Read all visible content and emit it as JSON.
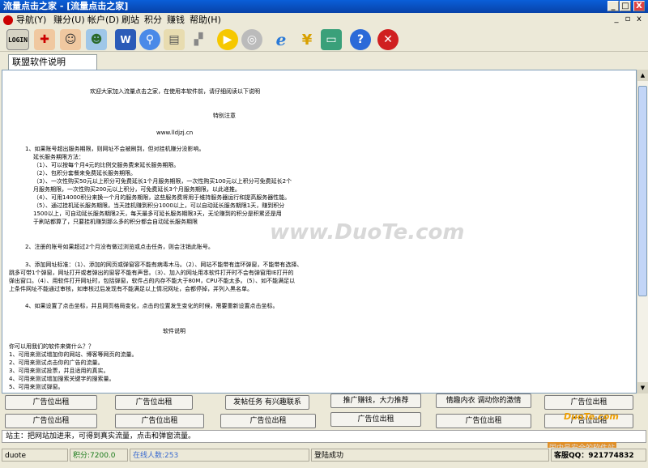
{
  "window": {
    "title": "流量点击之家 - [流量点击之家]",
    "buttons": [
      "_",
      "□",
      "X"
    ]
  },
  "menu": {
    "items": [
      "导航(Y)",
      "赚分(U)",
      "帐户(D)",
      "刷站",
      "积分",
      "赚钱",
      "帮助(H)"
    ],
    "mdi_buttons": [
      "_",
      "▫",
      "x"
    ]
  },
  "toolbar": {
    "icons": [
      "login-icon",
      "add-user-icon",
      "user-icon",
      "group-icon",
      "word-document-icon",
      "search-icon",
      "clipboard-icon",
      "signal-bars-icon",
      "play-icon",
      "stop-icon",
      "internet-explorer-icon",
      "money-icon",
      "cash-icon",
      "help-icon",
      "close-icon"
    ],
    "login_text": "LOGIN"
  },
  "tab": {
    "label": "联盟软件说明"
  },
  "content": {
    "lines": [
      "欢迎大家加入流量点击之家，在使用本软件前，请仔细阅读以下说明",
      "特别注意",
      "www.lldjzj.cn",
      "1、如果账号超出服务期限，则网址不会被刷到，但对挂机赚分没影响。",
      "延长服务期限方法：",
      "（1）、可以按每个月4元的比例交服务费来延长服务期限。",
      "（2）、包积分套餐来免费延长服务期限。",
      "（3）、一次性购买50元以上积分可免费延长1个月服务期限，一次性购买100元以上积分可免费延长2个",
      "月服务期限，一次性购买200元以上积分，可免费延长3个月服务期限，以此递推。",
      "（4）、可用14000积分来换一个月的服务期限，这些服务费将用于维持服务器运行和提高服务器性能。",
      "（5）、通过挂机延长服务期限，当天挂机赚到积分1000以上，可以自动延长服务期限1天，赚到积分",
      "1500以上，可自动延长服务期限2天，每天最多可延长服务期限3天，无论赚到的积分是积累还是用",
      "于刷站都算了，只要挂机赚到那么多的积分都会自动延长服务期限",
      "2、注册的账号如果超过2个月没有做过浏览或点击任务，则会注销此账号。",
      "3、添加网址标准：（1）、添加的网页或弹窗容不能有病毒木马。（2）、网站不能带有连环弹窗，不能带有选择、",
      "跳多可带1个弹窗，网址打开或者弹出的窗容不能有声音。（3）、加入的网址用本软件打开时不会有弹窗用IE打开的",
      "弹出窗口。（4）、用软件打开网址时，包括弹窗，软件占的内存不能大于80M，CPU不能太多。（5）、如不能满足以",
      "上条件网址不能通过审核，如审核过后发现有不能满足以上情况网址，会都停掉，并列入黑名单。",
      "4、如果设置了点击坐标，并且网页格局变化，点击的位置发生变化的时候，需要重新设置点击坐标。",
      "软件说明",
      "你可以用我们的软件来做什么？？",
      "1、可用来测试增加你的网站、博客等网页的流量。",
      "2、可用来测试点击你的广告的流量。",
      "3、可用来测试投票，并且适用的真实。",
      "4、可用来测试增加搜索关键字的搜索量。",
      "5、可用来测试弹窗。"
    ]
  },
  "ads": {
    "row1": [
      "广告位出租",
      "广告位出租",
      "发帖任务 有兴趣联系",
      "推广赚钱，大力推荐",
      "情趣内衣 调动你的激情",
      "广告位出租"
    ],
    "row2": [
      "广告位出租",
      "广告位出租",
      "广告位出租",
      "广告位出租",
      "广告位出租",
      "广告位出租"
    ]
  },
  "station_note": "站主：把网站加进来，可得到真实流量，点击和弹窗流量。",
  "status": {
    "username": "duote",
    "points_label": "积分:7200.0",
    "online_label": "在线人数:253",
    "message": "登陆成功",
    "qq": "客服QQ：921774832"
  },
  "watermarks": [
    "www.DuoTe.com",
    "DuoTe.com",
    "国内最安全的软件站"
  ],
  "colors": {
    "title_bar": "#0a5fd8",
    "points": "#1a7a1a",
    "online": "#3a6ad0"
  }
}
